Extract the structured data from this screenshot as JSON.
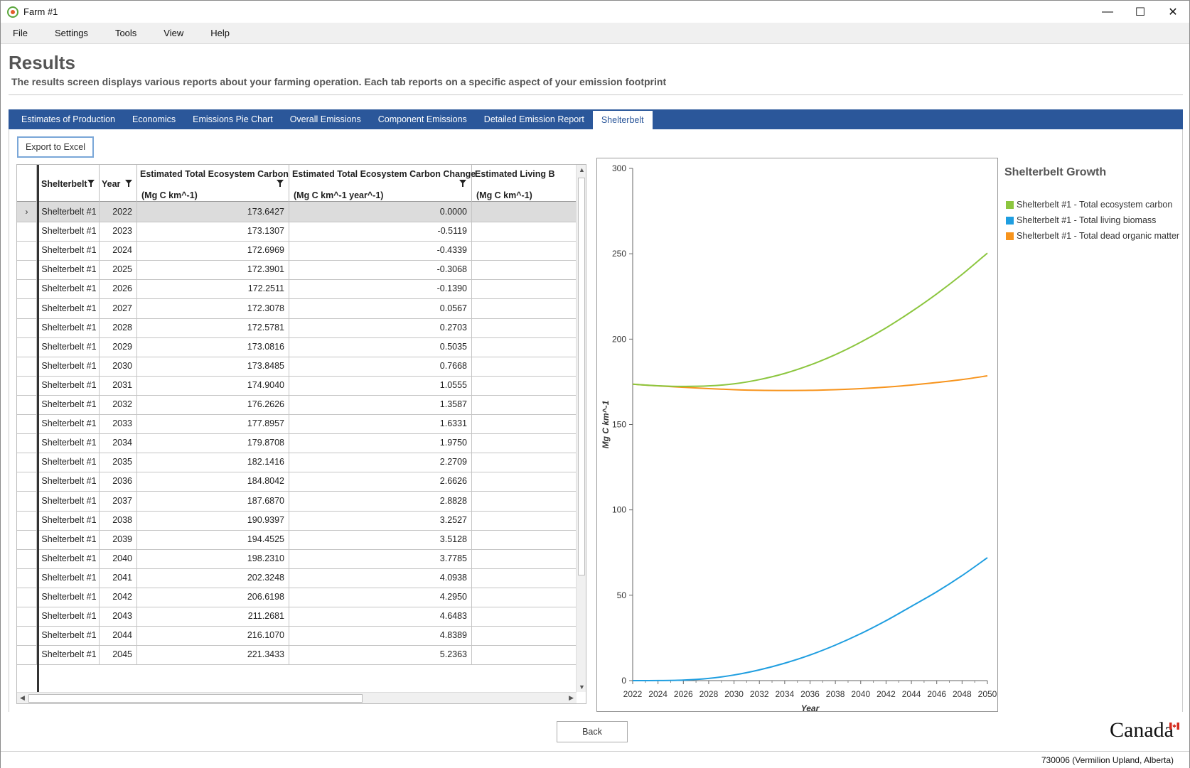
{
  "window": {
    "title": "Farm #1",
    "controls": [
      "—",
      "☐",
      "✕"
    ]
  },
  "menu": [
    "File",
    "Settings",
    "Tools",
    "View",
    "Help"
  ],
  "header": {
    "title": "Results",
    "subtitle": "The results screen displays various reports about your farming operation. Each tab reports on a specific aspect of your emission footprint"
  },
  "tabs": [
    "Estimates of Production",
    "Economics",
    "Emissions Pie Chart",
    "Overall Emissions",
    "Component Emissions",
    "Detailed Emission Report",
    "Shelterbelt"
  ],
  "active_tab": "Shelterbelt",
  "toolbar": {
    "export_label": "Export to Excel"
  },
  "grid": {
    "columns": [
      {
        "label": "Shelterbelt",
        "unit": ""
      },
      {
        "label": "Year",
        "unit": ""
      },
      {
        "label": "Estimated Total Ecosystem Carbon",
        "unit": "(Mg C km^-1)"
      },
      {
        "label": "Estimated Total Ecosystem Carbon Change",
        "unit": "(Mg C km^-1 year^-1)"
      },
      {
        "label": "Estimated Living B",
        "unit": "(Mg C km^-1)"
      }
    ],
    "selected_indicator": "›",
    "rows": [
      [
        "Shelterbelt #1",
        "2022",
        "173.6427",
        "0.0000"
      ],
      [
        "Shelterbelt #1",
        "2023",
        "173.1307",
        "-0.5119"
      ],
      [
        "Shelterbelt #1",
        "2024",
        "172.6969",
        "-0.4339"
      ],
      [
        "Shelterbelt #1",
        "2025",
        "172.3901",
        "-0.3068"
      ],
      [
        "Shelterbelt #1",
        "2026",
        "172.2511",
        "-0.1390"
      ],
      [
        "Shelterbelt #1",
        "2027",
        "172.3078",
        "0.0567"
      ],
      [
        "Shelterbelt #1",
        "2028",
        "172.5781",
        "0.2703"
      ],
      [
        "Shelterbelt #1",
        "2029",
        "173.0816",
        "0.5035"
      ],
      [
        "Shelterbelt #1",
        "2030",
        "173.8485",
        "0.7668"
      ],
      [
        "Shelterbelt #1",
        "2031",
        "174.9040",
        "1.0555"
      ],
      [
        "Shelterbelt #1",
        "2032",
        "176.2626",
        "1.3587"
      ],
      [
        "Shelterbelt #1",
        "2033",
        "177.8957",
        "1.6331"
      ],
      [
        "Shelterbelt #1",
        "2034",
        "179.8708",
        "1.9750"
      ],
      [
        "Shelterbelt #1",
        "2035",
        "182.1416",
        "2.2709"
      ],
      [
        "Shelterbelt #1",
        "2036",
        "184.8042",
        "2.6626"
      ],
      [
        "Shelterbelt #1",
        "2037",
        "187.6870",
        "2.8828"
      ],
      [
        "Shelterbelt #1",
        "2038",
        "190.9397",
        "3.2527"
      ],
      [
        "Shelterbelt #1",
        "2039",
        "194.4525",
        "3.5128"
      ],
      [
        "Shelterbelt #1",
        "2040",
        "198.2310",
        "3.7785"
      ],
      [
        "Shelterbelt #1",
        "2041",
        "202.3248",
        "4.0938"
      ],
      [
        "Shelterbelt #1",
        "2042",
        "206.6198",
        "4.2950"
      ],
      [
        "Shelterbelt #1",
        "2043",
        "211.2681",
        "4.6483"
      ],
      [
        "Shelterbelt #1",
        "2044",
        "216.1070",
        "4.8389"
      ],
      [
        "Shelterbelt #1",
        "2045",
        "221.3433",
        "5.2363"
      ]
    ]
  },
  "chart_data": {
    "type": "line",
    "title": "Shelterbelt Growth",
    "xlabel": "Year",
    "ylabel": "Mg C km^-1",
    "xlim": [
      2022,
      2050
    ],
    "ylim": [
      0,
      300
    ],
    "x_ticks": [
      "2022",
      "2024",
      "2026",
      "2028",
      "2030",
      "2032",
      "2034",
      "2036",
      "2038",
      "2040",
      "2042",
      "2044",
      "2046",
      "2048",
      "2050"
    ],
    "y_ticks": [
      "0",
      "50",
      "100",
      "150",
      "200",
      "250",
      "300"
    ],
    "x": [
      2022,
      2024,
      2026,
      2028,
      2030,
      2032,
      2034,
      2036,
      2038,
      2040,
      2042,
      2044,
      2046,
      2048,
      2050
    ],
    "legend_position": "right",
    "series": [
      {
        "name": "Shelterbelt #1 - Total ecosystem carbon",
        "color": "#8cc63f",
        "values": [
          173.6,
          172.7,
          172.3,
          172.6,
          173.8,
          176.3,
          179.9,
          184.8,
          190.9,
          198.2,
          206.6,
          216.1,
          226.5,
          237.9,
          250.4
        ]
      },
      {
        "name": "Shelterbelt #1 - Total living biomass",
        "color": "#1f9ee0",
        "values": [
          0.0,
          0.05,
          0.3,
          1.3,
          3.3,
          6.3,
          10.2,
          15.0,
          20.8,
          27.5,
          35.1,
          43.5,
          52.0,
          61.5,
          72.0
        ]
      },
      {
        "name": "Shelterbelt #1 - Total dead organic matter",
        "color": "#f7941d",
        "values": [
          173.6,
          172.6,
          171.8,
          171.0,
          170.4,
          170.0,
          169.9,
          170.0,
          170.4,
          171.0,
          171.9,
          173.1,
          174.6,
          176.3,
          178.5
        ]
      }
    ]
  },
  "footer": {
    "back_label": "Back",
    "wordmark": "Canada",
    "status": "730006 (Vermilion Upland, Alberta)"
  }
}
